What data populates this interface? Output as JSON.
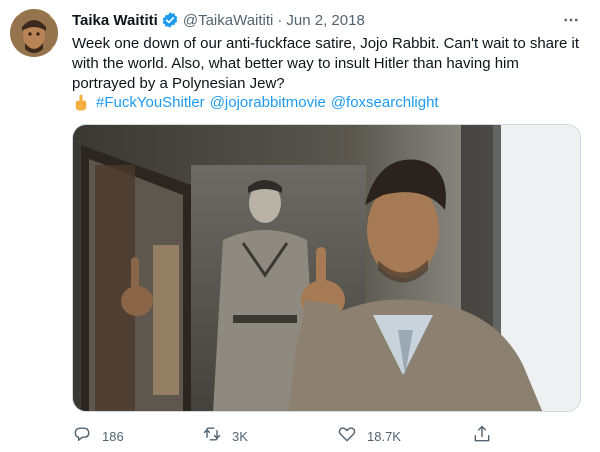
{
  "author": {
    "name": "Taika Waititi",
    "handle": "@TaikaWaititi",
    "separator": "·",
    "date": "Jun 2, 2018"
  },
  "tweet": {
    "text": "Week one down of our anti-fuckface satire, Jojo Rabbit. Can't wait to share it with the world. Also, what better way to insult Hitler than having him portrayed by a Polynesian Jew?",
    "hashtags": [
      "#FuckYouShitler",
      "@jojorabbitmovie",
      "@foxsearchlight"
    ]
  },
  "stats": {
    "replies": "186",
    "retweets": "3K",
    "likes": "18.7K"
  },
  "colors": {
    "link": "#1d9bf0",
    "secondary_text": "#536471",
    "verified_badge": "#1d9bf0"
  },
  "icons": {
    "verified": "verified-badge-icon",
    "more": "more-options-icon",
    "emoji": "middle-finger-emoji",
    "reply": "reply-icon",
    "retweet": "retweet-icon",
    "like": "heart-icon",
    "share": "share-icon"
  }
}
